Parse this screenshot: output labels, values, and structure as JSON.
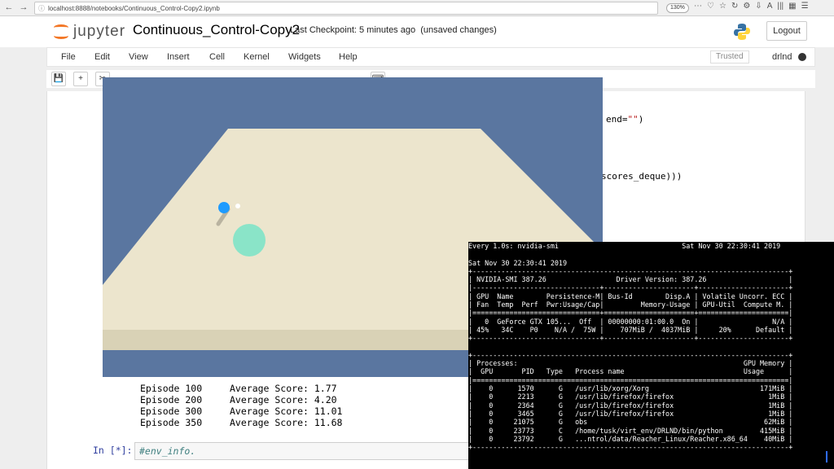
{
  "browser": {
    "url": "localhost:8888/notebooks/Continuous_Control-Copy2.ipynb",
    "zoom": "130%",
    "back_icon": "arrow-left-icon",
    "forward_icon": "arrow-right-icon",
    "reload_icon": "reload-icon"
  },
  "header": {
    "logo_text": "jupyter",
    "notebook_title": "Continuous_Control-Copy2",
    "checkpoint": "Last Checkpoint: 5 minutes ago",
    "unsaved": "(unsaved changes)",
    "logout_label": "Logout"
  },
  "menu": {
    "items": [
      "File",
      "Edit",
      "View",
      "Insert",
      "Cell",
      "Kernel",
      "Widgets",
      "Help"
    ],
    "trusted_label": "Trusted",
    "kernel_name": "drlnd"
  },
  "code": {
    "end_kw": "end=",
    "end_str": "\"\"",
    "end_close": ")",
    "scores_deque": "scores_deque)))"
  },
  "output": {
    "rows": [
      {
        "episode": "Episode 100",
        "avg": "Average Score: 1.77"
      },
      {
        "episode": "Episode 200",
        "avg": "Average Score: 4.20"
      },
      {
        "episode": "Episode 300",
        "avg": "Average Score: 11.01"
      },
      {
        "episode": "Episode 350",
        "avg": "Average Score: 11.68"
      }
    ]
  },
  "input_cell": {
    "prompt": "In [*]:",
    "code": "#env_info."
  },
  "terminal": {
    "lines": [
      "Every 1.0s: nvidia-smi                              Sat Nov 30 22:30:41 2019",
      "",
      "Sat Nov 30 22:30:41 2019",
      "+-----------------------------------------------------------------------------+",
      "| NVIDIA-SMI 387.26                 Driver Version: 387.26                    |",
      "|-------------------------------+----------------------+----------------------+",
      "| GPU  Name        Persistence-M| Bus-Id        Disp.A | Volatile Uncorr. ECC |",
      "| Fan  Temp  Perf  Pwr:Usage/Cap|         Memory-Usage | GPU-Util  Compute M. |",
      "|===============================+======================+======================|",
      "|   0  GeForce GTX 105...  Off  | 00000000:01:00.0  On |                  N/A |",
      "| 45%   34C    P0    N/A /  75W |    707MiB /  4037MiB |     20%      Default |",
      "+-------------------------------+----------------------+----------------------+",
      "",
      "+-----------------------------------------------------------------------------+",
      "| Processes:                                                       GPU Memory |",
      "|  GPU       PID   Type   Process name                             Usage      |",
      "|=============================================================================|",
      "|    0      1570      G   /usr/lib/xorg/Xorg                           171MiB |",
      "|    0      2213      G   /usr/lib/firefox/firefox                       1MiB |",
      "|    0      2364      G   /usr/lib/firefox/firefox                       1MiB |",
      "|    0      3465      G   /usr/lib/firefox/firefox                       1MiB |",
      "|    0     21075      G   obs                                           62MiB |",
      "|    0     23773      C   /home/tusk/virt_env/DRLND/bin/python         415MiB |",
      "|    0     23792      G   ...ntrol/data/Reacher_Linux/Reacher.x86_64    40MiB |",
      "+-----------------------------------------------------------------------------+"
    ]
  },
  "colors": {
    "game_sky": "#5a76a0",
    "floor": "#eee8d0",
    "target": "#7fe3c8",
    "arm_tip": "#1e9bff",
    "jupyter_orange": "#f37726"
  }
}
